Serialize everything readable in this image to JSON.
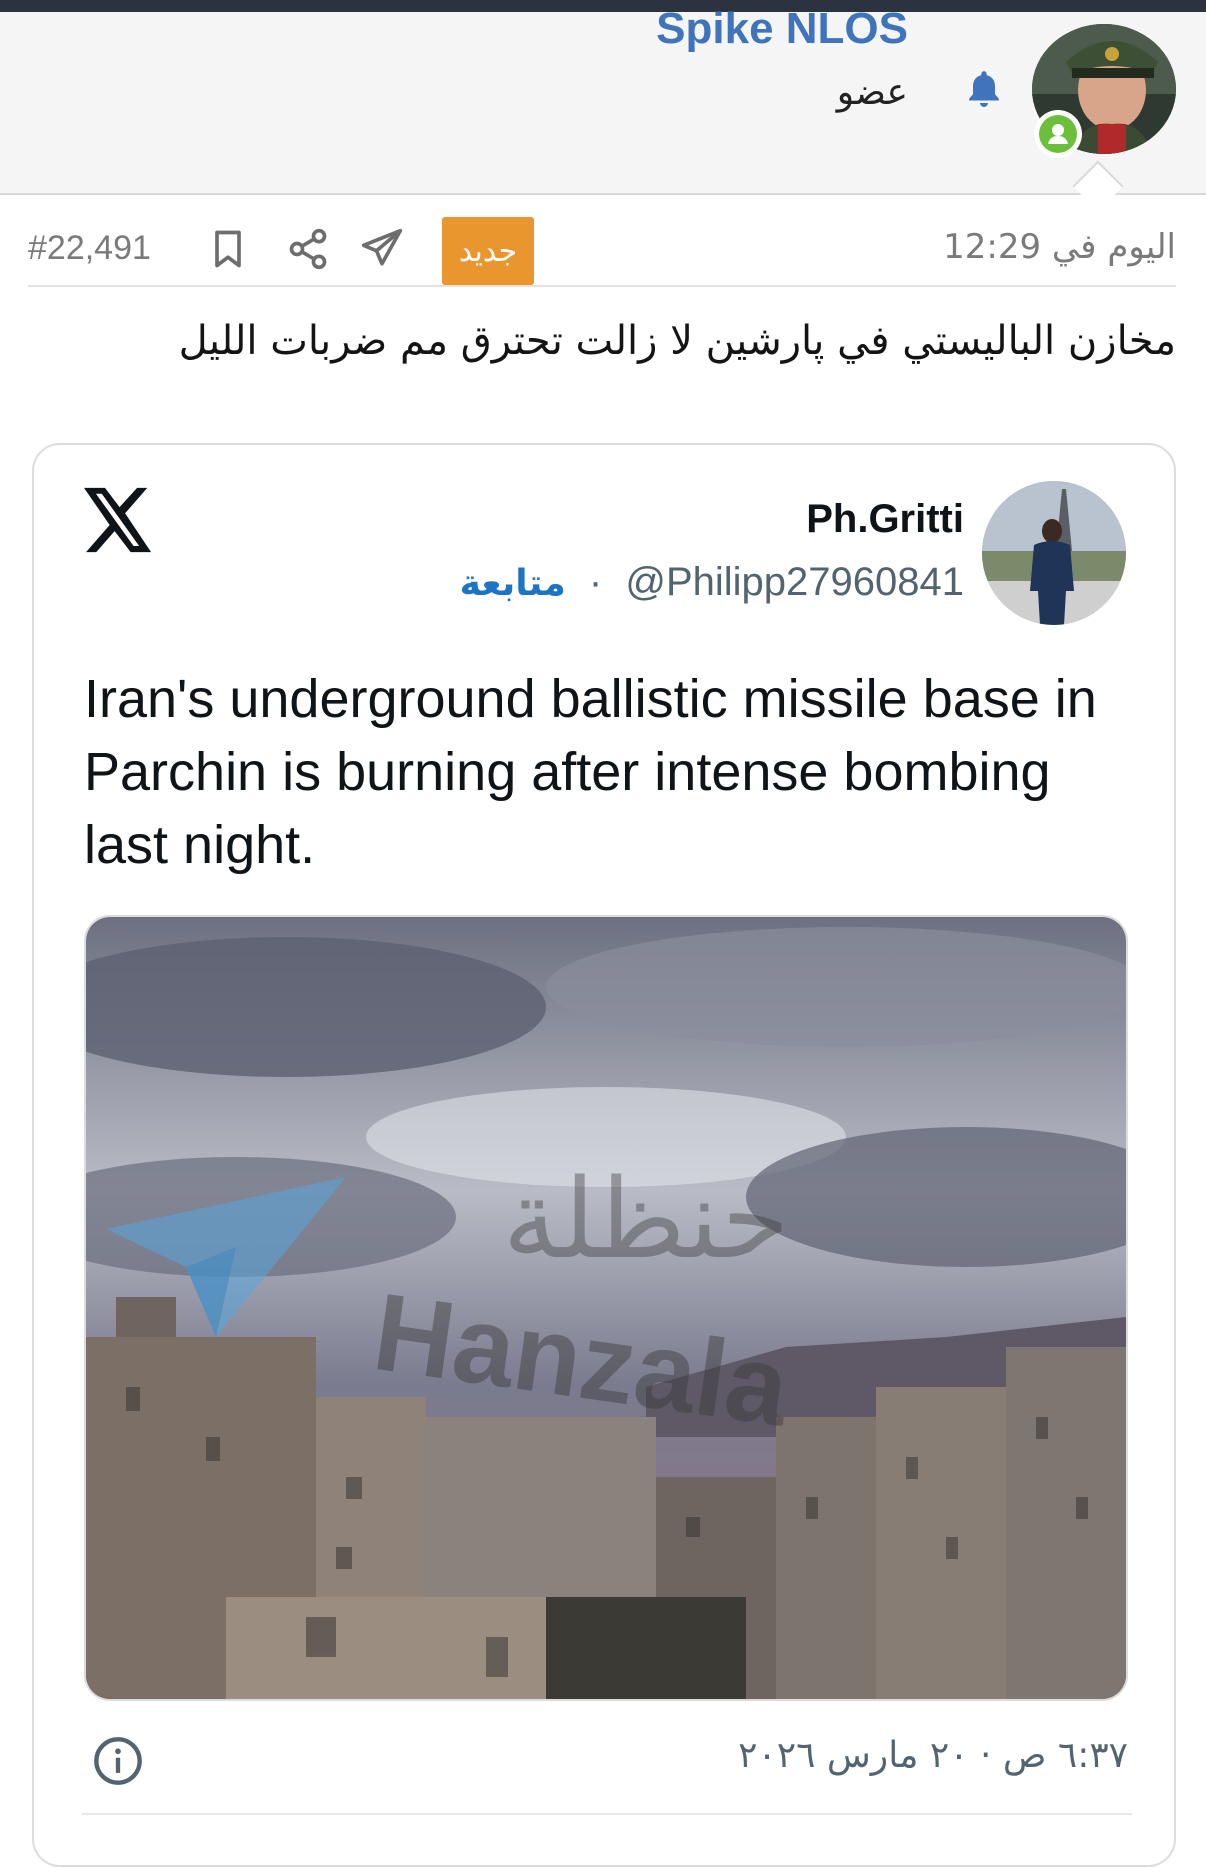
{
  "header": {
    "user_name": "Spike NLOS",
    "user_role": "عضو",
    "notification_icon": "bell-icon",
    "online_status_icon": "user-online-icon"
  },
  "post": {
    "number": "#22,491",
    "new_badge": "جديد",
    "time": "اليوم في 12:29",
    "text": "مخازن الباليستي في پارشين لا زالت تحترق مم ضربات الليل",
    "action_icons": [
      "bookmark-icon",
      "share-icon",
      "send-icon"
    ]
  },
  "tweet": {
    "platform_icon": "x-logo-icon",
    "author_name": "Ph.Gritti",
    "author_handle": "@Philipp27960841",
    "separator": "·",
    "follow_label": "متابعة",
    "body": "Iran's underground ballistic missile base in Parchin is burning after intense bombing last night.",
    "watermark_arabic": "حنظلة",
    "watermark_latin": "Hanzala",
    "date": "٦:٣٧ ص · ٢٠ مارس ٢٠٢٦",
    "info_icon": "info-icon"
  },
  "colors": {
    "accent_blue": "#3f74bd",
    "badge_orange": "#e9962f",
    "online_green": "#6cbf3a",
    "follow_blue": "#1d74c4"
  }
}
